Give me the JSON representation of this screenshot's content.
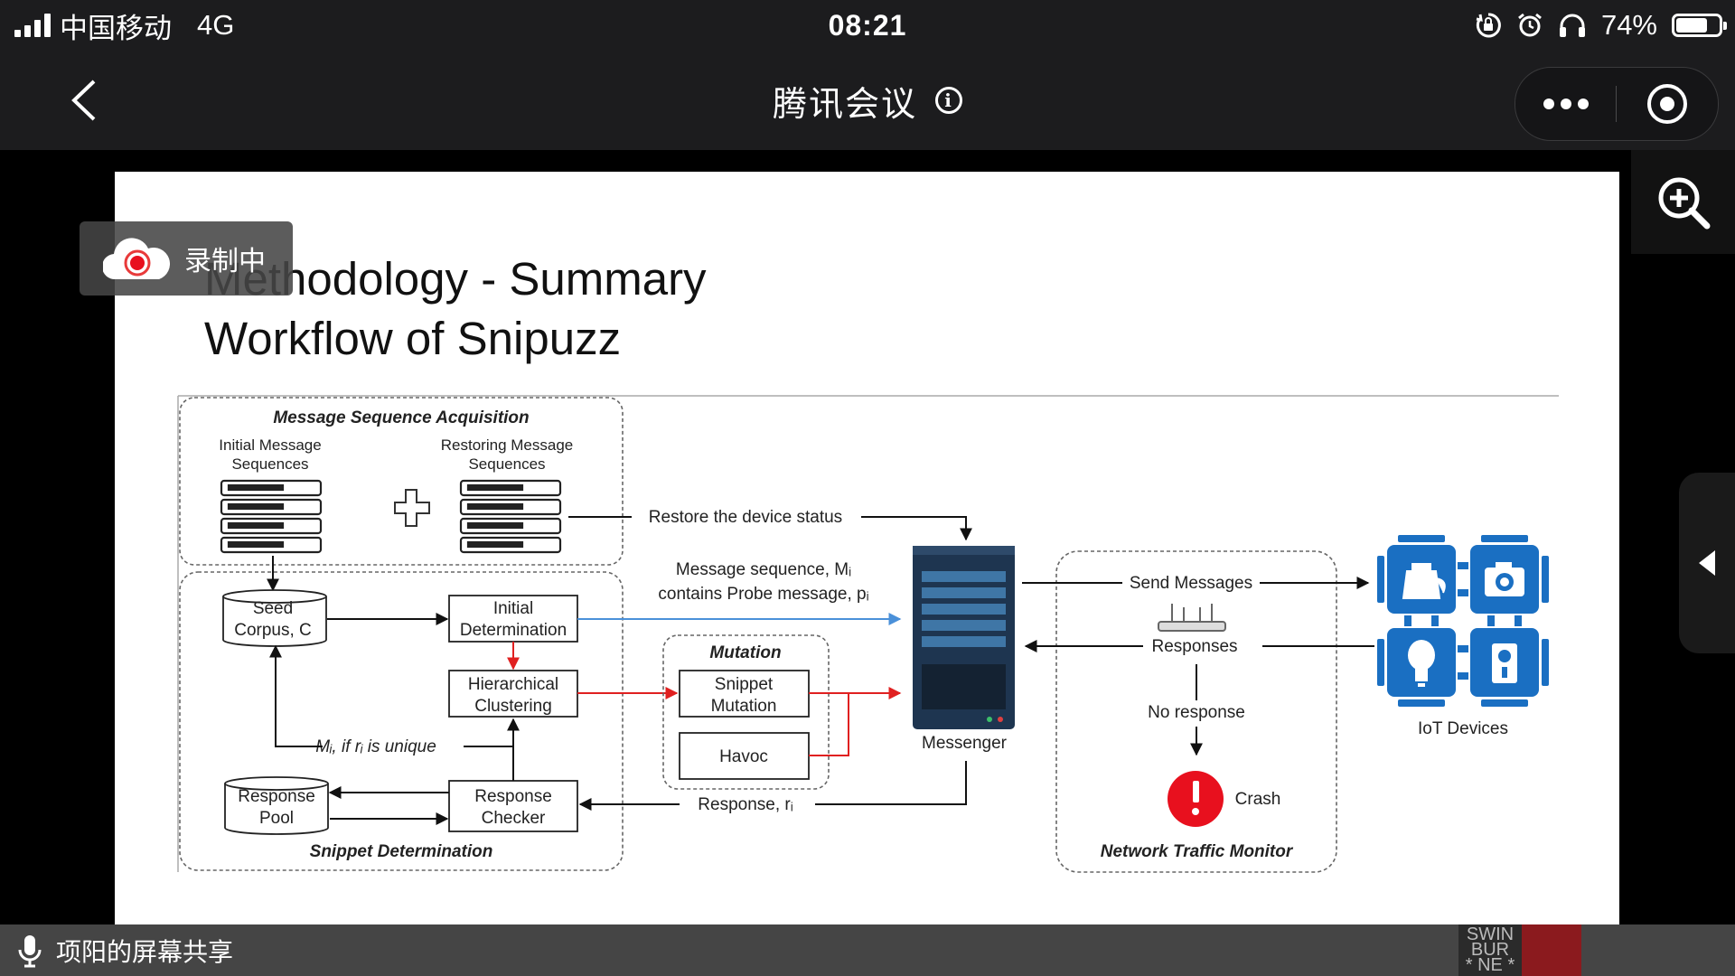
{
  "status_bar": {
    "carrier": "中国移动",
    "network": "4G",
    "time": "08:21",
    "battery": "74%",
    "battery_level": 0.74,
    "icons": [
      "signal-icon",
      "orientation-lock-icon",
      "alarm-icon",
      "headphones-icon",
      "battery-icon"
    ]
  },
  "nav": {
    "title": "腾讯会议",
    "back_icon": "chevron-left-icon",
    "info_icon": "info-icon",
    "more_icon": "more-dots-icon",
    "close_icon": "close-miniprogram-icon"
  },
  "recording": {
    "label": "录制中"
  },
  "slide": {
    "title_line1": "Methodology - Summary",
    "title_line2": "Workflow of Snipuzz",
    "diagram": {
      "msa_title": "Message Sequence Acquisition",
      "initial_line1": "Initial Message",
      "initial_line2": "Sequences",
      "restoring_line1": "Restoring Message",
      "restoring_line2": "Sequences",
      "restore_status": "Restore the device status",
      "msg_seq_line1": "Message sequence, Mᵢ",
      "msg_seq_line2": "contains Probe message, pᵢ",
      "seed_line1": "Seed",
      "seed_line2": "Corpus, C",
      "initial_det_line1": "Initial",
      "initial_det_line2": "Determination",
      "hier_line1": "Hierarchical",
      "hier_line2": "Clustering",
      "mutation_title": "Mutation",
      "snippet_mut_line1": "Snippet",
      "snippet_mut_line2": "Mutation",
      "havoc": "Havoc",
      "unique_label": "Mᵢ, if rᵢ is unique",
      "resp_pool_line1": "Response",
      "resp_pool_line2": "Pool",
      "resp_checker_line1": "Response",
      "resp_checker_line2": "Checker",
      "response_label": "Response, rᵢ",
      "snippet_det_title": "Snippet Determination",
      "messenger": "Messenger",
      "send_messages": "Send Messages",
      "responses": "Responses",
      "no_response": "No response",
      "crash": "Crash",
      "ntm_title": "Network Traffic Monitor",
      "iot_devices": "IoT Devices",
      "colors": {
        "blue_arrow": "#4a90d9",
        "red_arrow": "#e02020",
        "iot_blue": "#1a6fc2",
        "crash_red": "#e8101e",
        "server": "#1e3550"
      }
    }
  },
  "controls": {
    "zoom_icon": "zoom-in-icon",
    "side_icon": "triangle-left-icon"
  },
  "bottom": {
    "mic_icon": "microphone-icon",
    "share_label": "项阳的屏幕共享",
    "logo_line1": "SWIN",
    "logo_line2": "BUR",
    "logo_line3": "* NE *"
  }
}
